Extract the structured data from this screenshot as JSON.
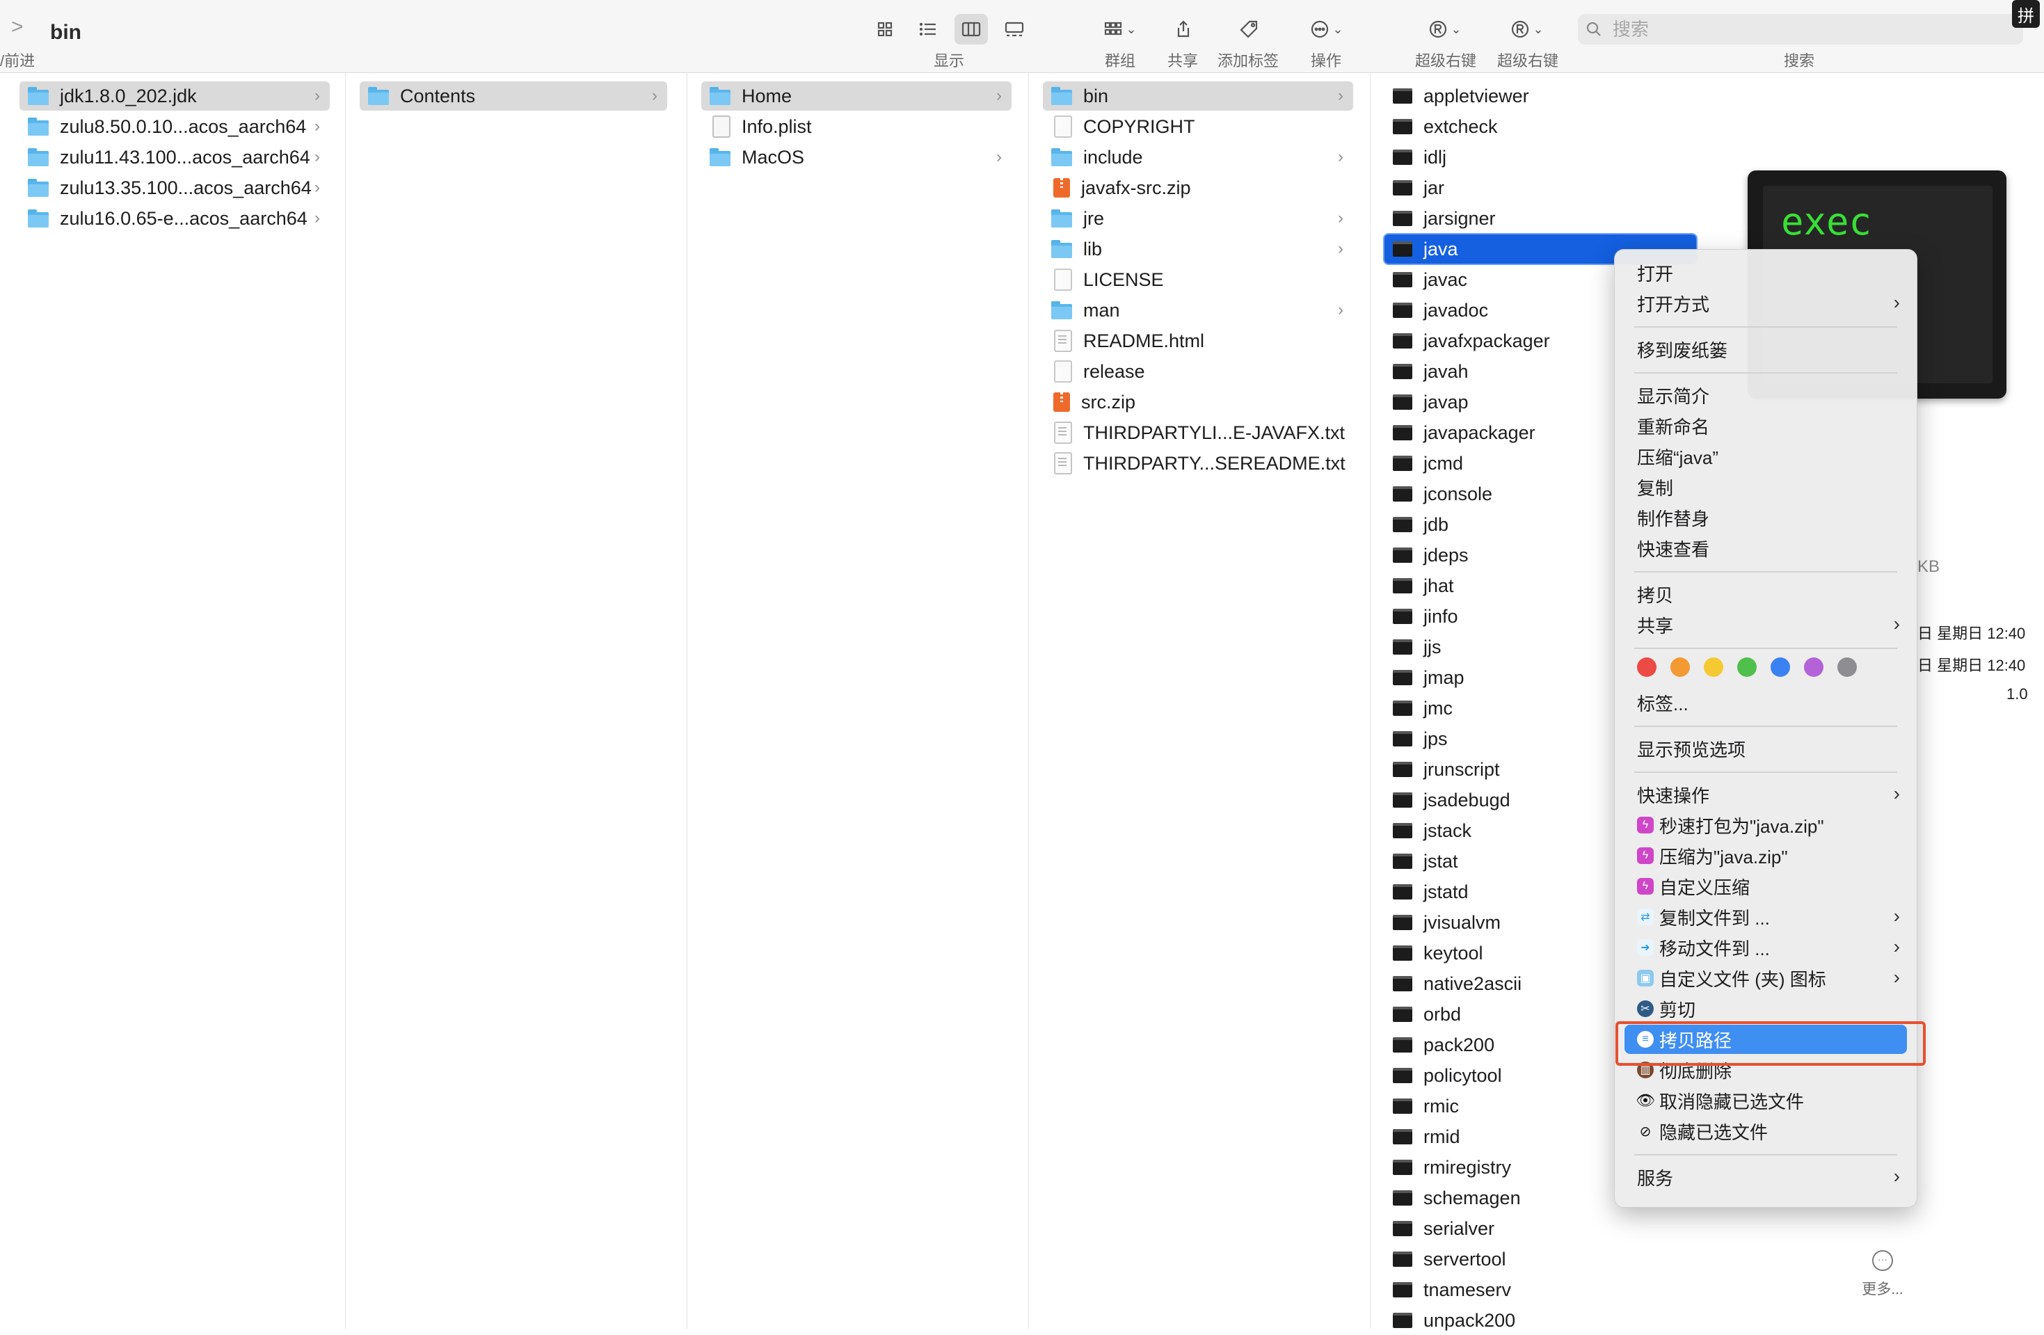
{
  "window": {
    "title": "bin",
    "forward_label": "/前进",
    "input_method_badge": "拼"
  },
  "toolbar": {
    "view_label": "显示",
    "group_label": "群组",
    "share_label": "共享",
    "add_tag_label": "添加标签",
    "action_label": "操作",
    "super_right_1_label": "超级右键",
    "super_right_2_label": "超级右键",
    "search_label": "搜索",
    "search_placeholder": "搜索"
  },
  "columns": {
    "col1": [
      {
        "name": "jdk1.8.0_202.jdk",
        "icon": "folder-icon"
      },
      {
        "name": "zulu8.50.0.10...acos_aarch64",
        "icon": "folder-icon"
      },
      {
        "name": "zulu11.43.100...acos_aarch64",
        "icon": "folder-icon"
      },
      {
        "name": "zulu13.35.100...acos_aarch64",
        "icon": "folder-icon"
      },
      {
        "name": "zulu16.0.65-e...acos_aarch64",
        "icon": "folder-icon"
      }
    ],
    "col2": [
      {
        "name": "Contents",
        "icon": "folder-icon"
      }
    ],
    "col3": [
      {
        "name": "Home",
        "icon": "folder-icon"
      },
      {
        "name": "Info.plist",
        "icon": "plist-icon"
      },
      {
        "name": "MacOS",
        "icon": "folder-icon"
      }
    ],
    "col4": [
      {
        "name": "bin",
        "icon": "folder-icon"
      },
      {
        "name": "COPYRIGHT",
        "icon": "document-icon"
      },
      {
        "name": "include",
        "icon": "folder-icon"
      },
      {
        "name": "javafx-src.zip",
        "icon": "zip-icon"
      },
      {
        "name": "jre",
        "icon": "folder-icon"
      },
      {
        "name": "lib",
        "icon": "folder-icon"
      },
      {
        "name": "LICENSE",
        "icon": "document-icon"
      },
      {
        "name": "man",
        "icon": "folder-icon"
      },
      {
        "name": "README.html",
        "icon": "text-document-icon"
      },
      {
        "name": "release",
        "icon": "document-icon"
      },
      {
        "name": "src.zip",
        "icon": "zip-icon"
      },
      {
        "name": "THIRDPARTYLI...E-JAVAFX.txt",
        "icon": "text-document-icon"
      },
      {
        "name": "THIRDPARTY...SEREADME.txt",
        "icon": "text-document-icon"
      }
    ],
    "col5": [
      "appletviewer",
      "extcheck",
      "idlj",
      "jar",
      "jarsigner",
      "java",
      "javac",
      "javadoc",
      "javafxpackager",
      "javah",
      "javap",
      "javapackager",
      "jcmd",
      "jconsole",
      "jdb",
      "jdeps",
      "jhat",
      "jinfo",
      "jjs",
      "jmap",
      "jmc",
      "jps",
      "jrunscript",
      "jsadebugd",
      "jstack",
      "jstat",
      "jstatd",
      "jvisualvm",
      "keytool",
      "native2ascii",
      "orbd",
      "pack200",
      "policytool",
      "rmic",
      "rmid",
      "rmiregistry",
      "schemagen",
      "serialver",
      "servertool",
      "tnameserv",
      "unpack200"
    ]
  },
  "preview": {
    "thumb_text": "exec",
    "size_fragment": "KB",
    "created": "日 星期日 12:40",
    "modified": "日 星期日 12:40",
    "version": "1.0",
    "more_label": "更多..."
  },
  "context_menu": {
    "open": "打开",
    "open_with": "打开方式",
    "move_to_trash": "移到废纸篓",
    "get_info": "显示简介",
    "rename": "重新命名",
    "compress": "压缩“java”",
    "duplicate": "复制",
    "make_alias": "制作替身",
    "quick_look": "快速查看",
    "copy": "拷贝",
    "share": "共享",
    "tags": "标签...",
    "show_preview_options": "显示预览选项",
    "quick_actions": "快速操作",
    "fast_zip": "秒速打包为\"java.zip\"",
    "compress_zip": "压缩为\"java.zip\"",
    "custom_compress": "自定义压缩",
    "copy_file_to": "复制文件到 ...",
    "move_file_to": "移动文件到 ...",
    "custom_icon": "自定义文件 (夹) 图标",
    "cut": "剪切",
    "copy_path": "拷贝路径",
    "delete_permanently": "彻底删除",
    "unhide_selected": "取消隐藏已选文件",
    "hide_selected": "隐藏已选文件",
    "services": "服务",
    "tag_colors": [
      "#ec4a44",
      "#f39a33",
      "#f5c932",
      "#4fc04b",
      "#3a82f2",
      "#b462d8",
      "#8e8e92"
    ]
  },
  "colors": {
    "selection_blue": "#1460e0",
    "menu_highlight": "#3f8ef2",
    "annotation_red": "#e8502f",
    "folder_blue": "#59b6ec"
  }
}
